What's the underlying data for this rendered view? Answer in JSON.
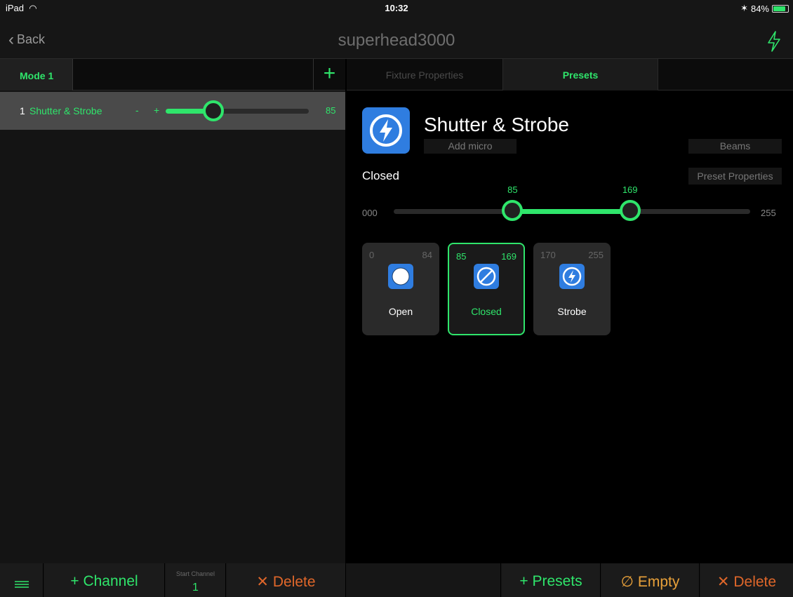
{
  "status": {
    "device": "iPad",
    "time": "10:32",
    "battery": "84%",
    "battery_level": 0.84
  },
  "nav": {
    "back_label": "Back",
    "title": "superhead3000"
  },
  "left": {
    "mode_tab": "Mode 1",
    "channel": {
      "number": "1",
      "name": "Shutter & Strobe",
      "minus": "-",
      "plus": "+",
      "value": "85",
      "value_level": 0.333
    }
  },
  "right": {
    "tabs": [
      "Fixture Properties",
      "Presets"
    ],
    "active_tab": "Presets",
    "preset_title": "Shutter & Strobe",
    "add_micro": "Add micro",
    "beams": "Beams",
    "current_preset": "Closed",
    "preset_properties": "Preset Properties",
    "range": {
      "min_label": "000",
      "max_label": "255",
      "low": "85",
      "high": "169",
      "low_value": 85,
      "high_value": 169,
      "max": 255
    },
    "cards": [
      {
        "lo": "0",
        "hi": "84",
        "label": "Open",
        "icon": "open-circle-icon",
        "selected": false
      },
      {
        "lo": "85",
        "hi": "169",
        "label": "Closed",
        "icon": "closed-slash-icon",
        "selected": true
      },
      {
        "lo": "170",
        "hi": "255",
        "label": "Strobe",
        "icon": "strobe-bolt-icon",
        "selected": false
      }
    ]
  },
  "bottom": {
    "add_channel": "Channel",
    "start_channel_label": "Start Channel",
    "start_channel_value": "1",
    "delete_left": "Delete",
    "add_presets": "Presets",
    "empty": "Empty",
    "delete_right": "Delete"
  },
  "colors": {
    "accent": "#2fe56b",
    "danger": "#e0672a",
    "warning": "#e9a13a",
    "icon_blue": "#2f7de0"
  }
}
